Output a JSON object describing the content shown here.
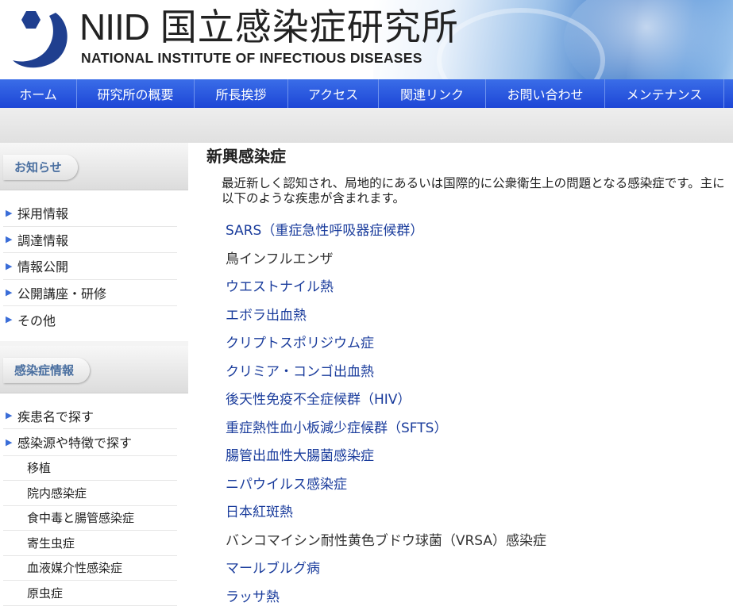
{
  "header": {
    "logo_niid": "NIID",
    "logo_jp": "国立感染症研究所",
    "logo_en": "NATIONAL INSTITUTE OF INFECTIOUS DISEASES"
  },
  "nav": {
    "items": [
      "ホーム",
      "研究所の概要",
      "所長挨拶",
      "アクセス",
      "関連リンク",
      "お問い合わせ",
      "メンテナンス"
    ]
  },
  "sidebar": {
    "news_heading": "お知らせ",
    "news_items": [
      "採用情報",
      "調達情報",
      "情報公開",
      "公開講座・研修",
      "その他"
    ],
    "infection_heading": "感染症情報",
    "infection_items": [
      "疾患名で探す",
      "感染源や特徴で探す"
    ],
    "infection_subitems": [
      "移植",
      "院内感染症",
      "食中毒と腸管感染症",
      "寄生虫症",
      "血液媒介性感染症",
      "原虫症"
    ]
  },
  "main": {
    "title": "新興感染症",
    "intro": "最近新しく認知され、局地的にあるいは国際的に公衆衛生上の問題となる感染症です。主に以下のような疾患が含まれます。",
    "diseases": [
      {
        "label": "SARS（重症急性呼吸器症候群）",
        "link": true
      },
      {
        "label": "鳥インフルエンザ",
        "link": false
      },
      {
        "label": "ウエストナイル熱",
        "link": true
      },
      {
        "label": "エボラ出血熱",
        "link": true
      },
      {
        "label": "クリプトスポリジウム症",
        "link": true
      },
      {
        "label": "クリミア・コンゴ出血熱",
        "link": true
      },
      {
        "label": "後天性免疫不全症候群（HIV）",
        "link": true
      },
      {
        "label": "重症熱性血小板減少症候群（SFTS）",
        "link": true
      },
      {
        "label": "腸管出血性大腸菌感染症",
        "link": true
      },
      {
        "label": "ニパウイルス感染症",
        "link": true
      },
      {
        "label": "日本紅斑熱",
        "link": true
      },
      {
        "label": "バンコマイシン耐性黄色ブドウ球菌（VRSA）感染症",
        "link": false
      },
      {
        "label": "マールブルグ病",
        "link": true
      },
      {
        "label": "ラッサ熱",
        "link": true
      }
    ]
  },
  "colors": {
    "nav_blue": "#1d46d6",
    "link_blue": "#1a3c9c",
    "logo_blue": "#1f3f8f",
    "sidebar_heading": "#4a6fa0"
  }
}
